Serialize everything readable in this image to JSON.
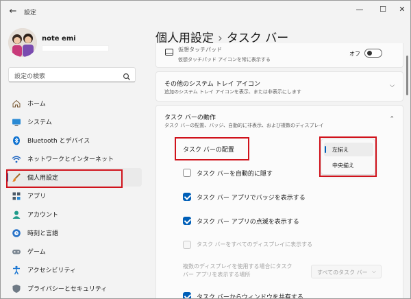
{
  "window": {
    "title": "設定"
  },
  "profile": {
    "name": "note emi"
  },
  "search": {
    "placeholder": "設定の検索"
  },
  "sidebar": {
    "items": [
      {
        "label": "ホーム",
        "icon": "home-icon"
      },
      {
        "label": "システム",
        "icon": "monitor-icon"
      },
      {
        "label": "Bluetooth とデバイス",
        "icon": "bluetooth-icon"
      },
      {
        "label": "ネットワークとインターネット",
        "icon": "wifi-icon"
      },
      {
        "label": "個人用設定",
        "icon": "paintbrush-icon",
        "active": true
      },
      {
        "label": "アプリ",
        "icon": "apps-icon"
      },
      {
        "label": "アカウント",
        "icon": "person-icon"
      },
      {
        "label": "時刻と言語",
        "icon": "clock-globe-icon"
      },
      {
        "label": "ゲーム",
        "icon": "gamepad-icon"
      },
      {
        "label": "アクセシビリティ",
        "icon": "accessibility-icon"
      },
      {
        "label": "プライバシーとセキュリティ",
        "icon": "shield-icon"
      }
    ]
  },
  "header": {
    "crumb": "個人用設定",
    "separator": "›",
    "current": "タスク バー"
  },
  "cards": {
    "touchpad": {
      "title": "仮想タッチパッド",
      "subtitle": "仮想タッチパッド アイコンを常に表示する",
      "toggle_label": "オフ",
      "toggle_on": false
    },
    "tray": {
      "title": "その他のシステム トレイ アイコン",
      "subtitle": "追加のシステム トレイ アイコンを表示、または非表示にします"
    },
    "behavior": {
      "title": "タスク バーの動作",
      "subtitle": "タスク バーの配置、バッジ、自動的に非表示、および複数のディスプレイ",
      "alignment_label": "タスク バーの配置",
      "alignment_options": [
        "左揃え",
        "中央揃え"
      ],
      "alignment_selected": "左揃え",
      "options": [
        {
          "label": "タスク バーを自動的に隠す",
          "checked": false,
          "enabled": true
        },
        {
          "label": "タスク バー アプリでバッジを表示する",
          "checked": true,
          "enabled": true
        },
        {
          "label": "タスク バー アプリの点滅を表示する",
          "checked": true,
          "enabled": true
        },
        {
          "label": "タスク バーをすべてのディスプレイに表示する",
          "checked": false,
          "enabled": false
        }
      ],
      "multi_display_label_line1": "複数のディスプレイを使用する場合にタスク",
      "multi_display_label_line2": "バー アプリを表示する場所",
      "multi_display_value": "すべてのタスク バー",
      "share_label": "タスク バーからウィンドウを共有する",
      "share_checked": true
    }
  },
  "colors": {
    "accent": "#005fb8",
    "highlight": "#d0121b"
  }
}
